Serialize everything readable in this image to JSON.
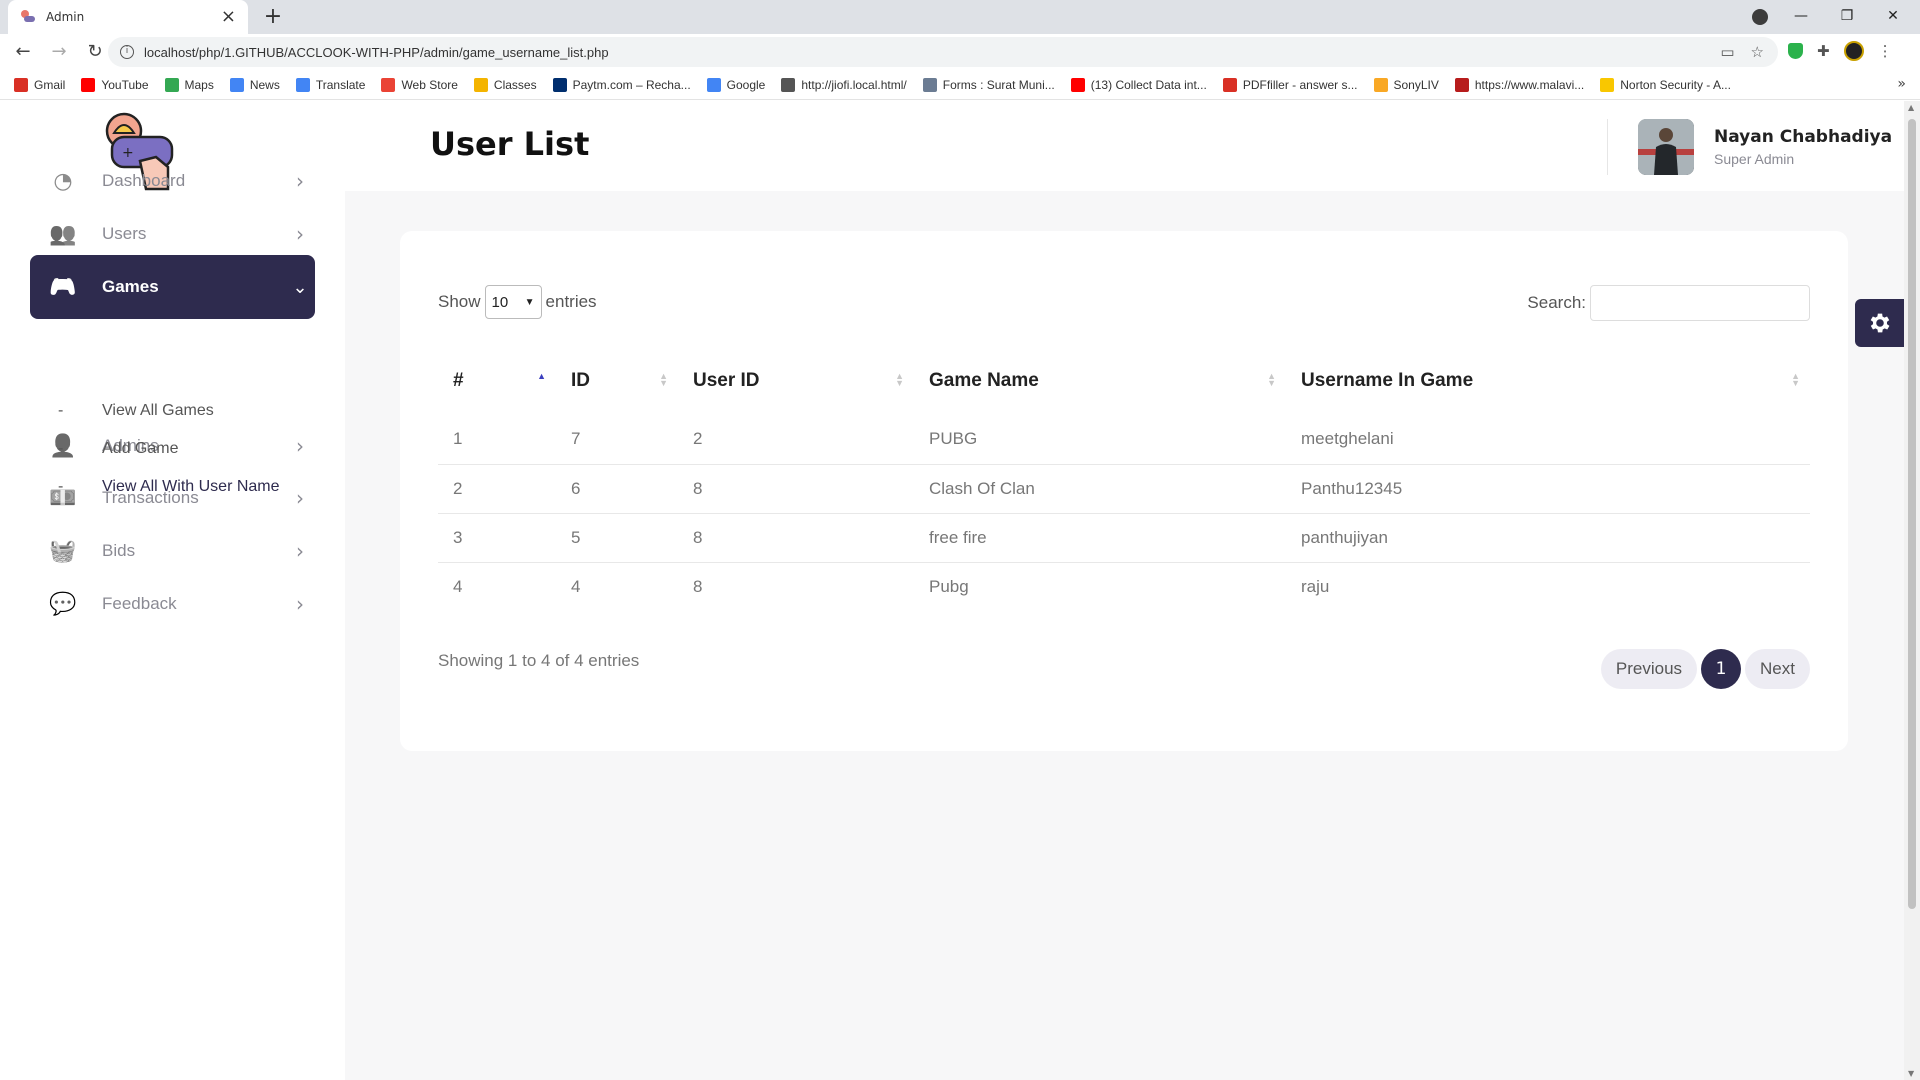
{
  "browser": {
    "tab_title": "Admin",
    "url": "localhost/php/1.GITHUB/ACCLOOK-WITH-PHP/admin/game_username_list.php",
    "bookmarks": [
      {
        "label": "Gmail",
        "color": "#d93025"
      },
      {
        "label": "YouTube",
        "color": "#ff0000"
      },
      {
        "label": "Maps",
        "color": "#34a853"
      },
      {
        "label": "News",
        "color": "#4285f4"
      },
      {
        "label": "Translate",
        "color": "#4285f4"
      },
      {
        "label": "Web Store",
        "color": "#ea4335"
      },
      {
        "label": "Classes",
        "color": "#f4b400"
      },
      {
        "label": "Paytm.com – Recha...",
        "color": "#002e6e"
      },
      {
        "label": "Google",
        "color": "#4285f4"
      },
      {
        "label": "http://jiofi.local.html/",
        "color": "#555555"
      },
      {
        "label": "Forms : Surat Muni...",
        "color": "#6b7c93"
      },
      {
        "label": "(13) Collect Data int...",
        "color": "#ff0000"
      },
      {
        "label": "PDFfiller - answer s...",
        "color": "#d93025"
      },
      {
        "label": "SonyLIV",
        "color": "#f9a825"
      },
      {
        "label": "https://www.malavi...",
        "color": "#b71c1c"
      },
      {
        "label": "Norton Security - A...",
        "color": "#f9c700"
      }
    ]
  },
  "sidebar": {
    "items": [
      {
        "label": "Dashboard",
        "icon": "dashboard-icon"
      },
      {
        "label": "Users",
        "icon": "users-icon"
      },
      {
        "label": "Games",
        "icon": "gamepad-icon",
        "active": true
      },
      {
        "label": "Admins",
        "icon": "user-icon"
      },
      {
        "label": "Transactions",
        "icon": "money-icon"
      },
      {
        "label": "Bids",
        "icon": "basket-icon"
      },
      {
        "label": "Feedback",
        "icon": "comments-icon"
      }
    ],
    "sub_items": [
      {
        "label": "View All Games"
      },
      {
        "label": "Add Game"
      },
      {
        "label": "View All With User Name",
        "current": true
      }
    ]
  },
  "header": {
    "title": "User List",
    "user_name": "Nayan Chabhadiya",
    "user_role": "Super Admin"
  },
  "table_controls": {
    "show_label": "Show",
    "entries_value": "10",
    "entries_label": "entries",
    "search_label": "Search:"
  },
  "table": {
    "columns": [
      "#",
      "ID",
      "User ID",
      "Game Name",
      "Username In Game"
    ],
    "rows": [
      [
        "1",
        "7",
        "2",
        "PUBG",
        "meetghelani"
      ],
      [
        "2",
        "6",
        "8",
        "Clash Of Clan",
        "Panthu12345"
      ],
      [
        "3",
        "5",
        "8",
        "free fire",
        "panthujiyan"
      ],
      [
        "4",
        "4",
        "8",
        "Pubg",
        "raju"
      ]
    ]
  },
  "footer": {
    "info": "Showing 1 to 4 of 4 entries",
    "prev_label": "Previous",
    "page": "1",
    "next_label": "Next"
  },
  "colors": {
    "accent": "#2e2b4e",
    "page_bg": "#f7f7f8"
  }
}
